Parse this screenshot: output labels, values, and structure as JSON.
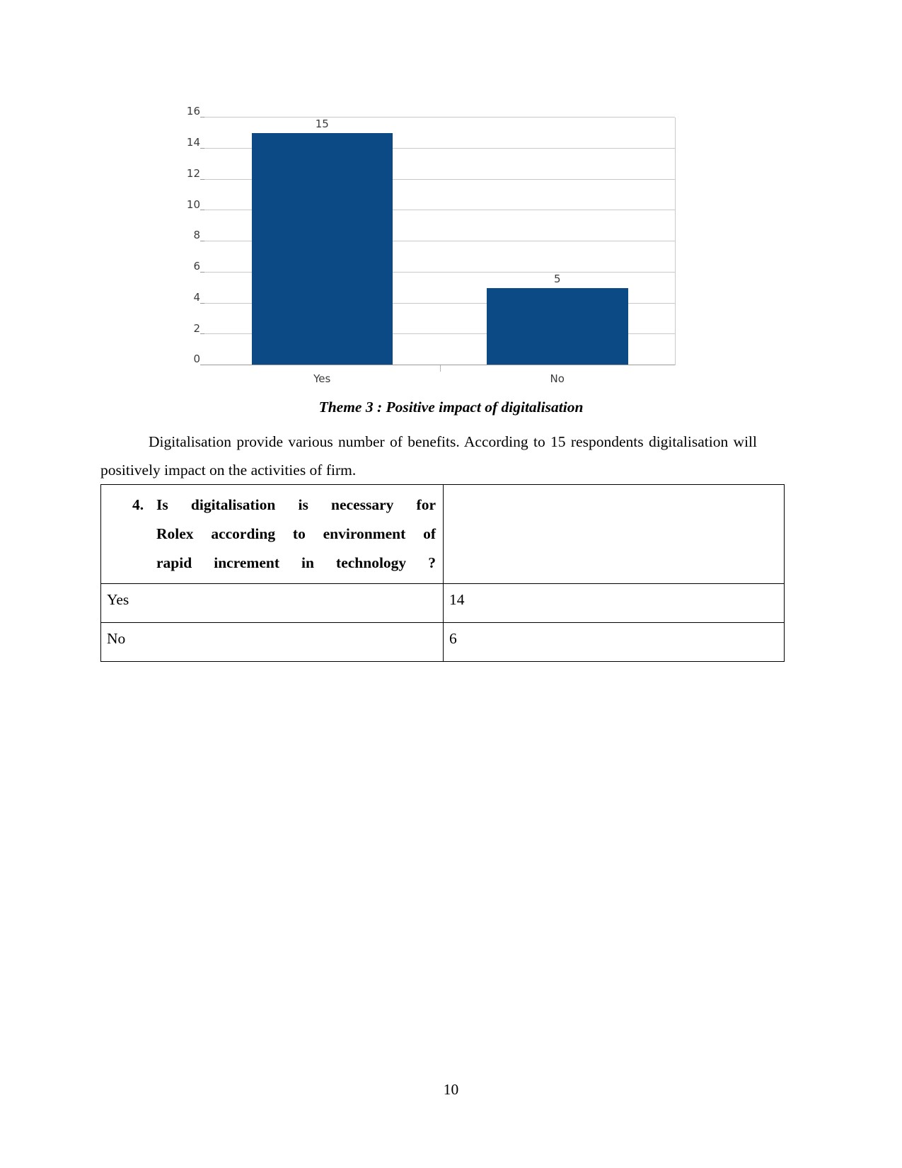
{
  "chart_data": {
    "type": "bar",
    "categories": [
      "Yes",
      "No"
    ],
    "values": [
      15,
      5
    ],
    "data_labels": [
      "15",
      "5"
    ],
    "title": "",
    "xlabel": "",
    "ylabel": "",
    "ylim": [
      0,
      16
    ],
    "yticks": [
      0,
      2,
      4,
      6,
      8,
      10,
      12,
      14,
      16
    ],
    "ytick_labels": [
      "0",
      "2",
      "4",
      "6",
      "8",
      "10",
      "12",
      "14",
      "16"
    ],
    "grid": true,
    "legend": "none",
    "bar_color": "#0b4a85",
    "grid_color": "#c9c9c9",
    "axis_color": "#9a9a9a",
    "tick_text_color": "#3b3b3b"
  },
  "caption": {
    "text": "Theme 3 : Positive impact of digitalisation"
  },
  "paragraph": {
    "line1": "Digitalisation provide various number of benefits. According to 15 respondents",
    "line2": "digitalisation will positively impact on the activities of firm.",
    "full": "Digitalisation provide various number of benefits. According to 15 respondents digitalisation will positively impact on the activities of firm."
  },
  "table": {
    "question_number": "4.",
    "question_line1": "Is digitalisation is necessary for",
    "question_line2": "Rolex according to environment of",
    "question_line3": "rapid increment in technology ?",
    "header_value": "",
    "rows": [
      {
        "label": "Yes",
        "value": "14"
      },
      {
        "label": "No",
        "value": "6"
      }
    ]
  },
  "footer": {
    "page_number": "10"
  }
}
